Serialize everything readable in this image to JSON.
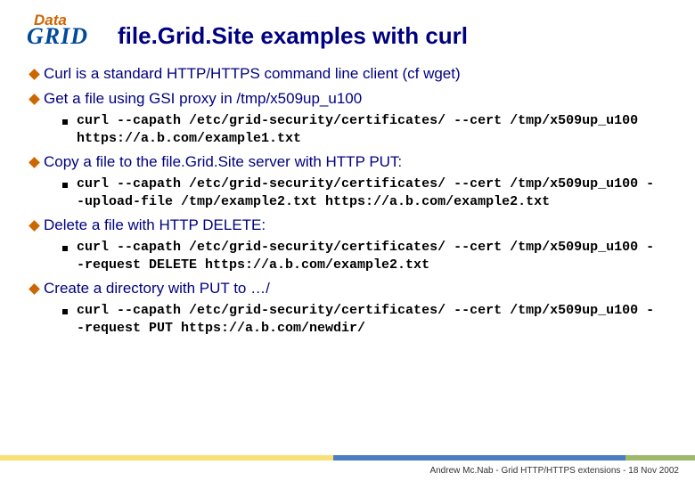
{
  "logo": {
    "top": "Data",
    "bottom": "GRID"
  },
  "title": "file.Grid.Site examples with curl",
  "bullets": [
    {
      "text": "Curl is a standard HTTP/HTTPS command line client (cf wget)",
      "sub": []
    },
    {
      "text": "Get a file using GSI proxy in /tmp/x509up_u100",
      "sub": [
        "curl --capath /etc/grid-security/certificates/ --cert /tmp/x509up_u100 https://a.b.com/example1.txt"
      ]
    },
    {
      "text": "Copy a file to the file.Grid.Site server with HTTP PUT:",
      "sub": [
        "curl --capath /etc/grid-security/certificates/ --cert /tmp/x509up_u100 --upload-file /tmp/example2.txt https://a.b.com/example2.txt"
      ]
    },
    {
      "text": "Delete a file with HTTP DELETE:",
      "sub": [
        "curl --capath /etc/grid-security/certificates/ --cert /tmp/x509up_u100 --request DELETE https://a.b.com/example2.txt"
      ]
    },
    {
      "text": "Create a directory with PUT to …/",
      "sub": [
        "curl --capath /etc/grid-security/certificates/ --cert /tmp/x509up_u100 --request PUT https://a.b.com/newdir/"
      ]
    }
  ],
  "footer": "Andrew Mc.Nab - Grid HTTP/HTTPS extensions - 18 Nov 2002"
}
